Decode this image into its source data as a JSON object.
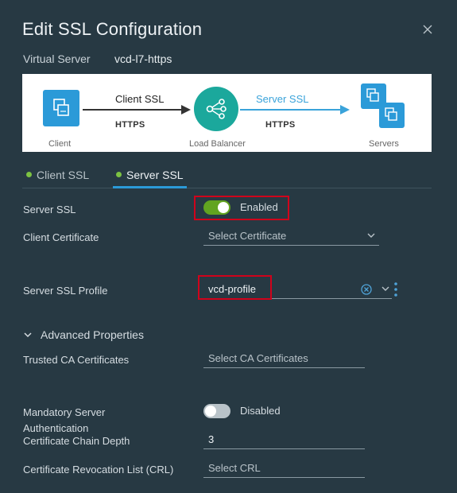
{
  "dialog": {
    "title": "Edit SSL Configuration",
    "virtual_server_label": "Virtual Server",
    "virtual_server_value": "vcd-l7-https"
  },
  "diagram": {
    "client_label": "Client",
    "lb_label": "Load Balancer",
    "servers_label": "Servers",
    "client_ssl": "Client SSL",
    "client_proto": "HTTPS",
    "server_ssl": "Server SSL",
    "server_proto": "HTTPS",
    "colors": {
      "box": "#2b9ad8",
      "lb": "#1ba89c",
      "server_arrow": "#3aa3da"
    }
  },
  "tabs": [
    {
      "label": "Client SSL",
      "active": false
    },
    {
      "label": "Server SSL",
      "active": true
    }
  ],
  "form": {
    "server_ssl": {
      "label": "Server SSL",
      "state": "Enabled"
    },
    "client_certificate": {
      "label": "Client Certificate",
      "placeholder": "Select Certificate"
    },
    "server_ssl_profile": {
      "label": "Server SSL Profile",
      "value": "vcd-profile"
    },
    "advanced": {
      "label": "Advanced Properties"
    },
    "trusted_ca": {
      "label": "Trusted CA Certificates",
      "placeholder": "Select CA Certificates"
    },
    "mandatory_auth": {
      "label_line1": "Mandatory Server",
      "label_line2": "Authentication",
      "state": "Disabled"
    },
    "chain_depth": {
      "label": "Certificate Chain Depth",
      "value": "3"
    },
    "crl": {
      "label": "Certificate Revocation List (CRL)",
      "placeholder": "Select CRL"
    }
  }
}
